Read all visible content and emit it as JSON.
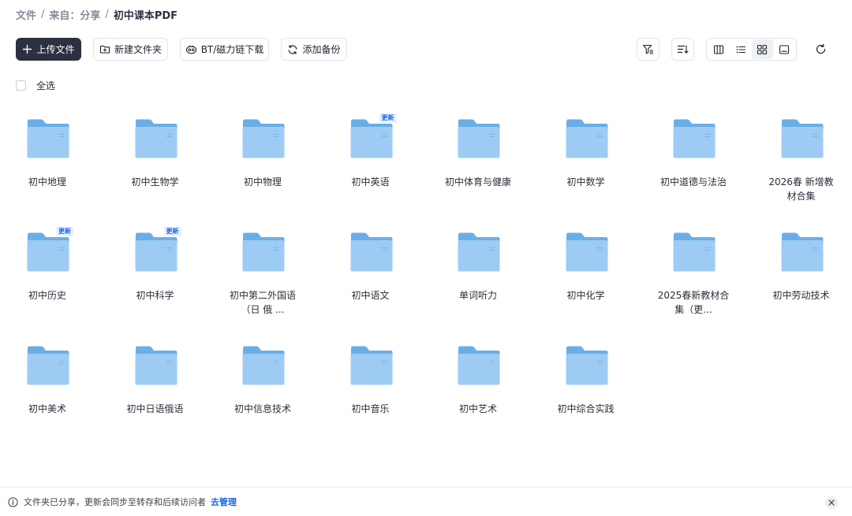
{
  "breadcrumb": {
    "items": [
      "文件",
      "来自：分享"
    ],
    "separator": "/",
    "current": "初中课本PDF"
  },
  "toolbar": {
    "upload_label": "上传文件",
    "new_folder_label": "新建文件夹",
    "bt_label": "BT/磁力链下载",
    "backup_label": "添加备份"
  },
  "select_all_label": "全选",
  "badge_label": "更新",
  "folders": [
    {
      "name": "初中地理",
      "updated": false
    },
    {
      "name": "初中生物学",
      "updated": false
    },
    {
      "name": "初中物理",
      "updated": false
    },
    {
      "name": "初中英语",
      "updated": true
    },
    {
      "name": "初中体育与健康",
      "updated": false
    },
    {
      "name": "初中数学",
      "updated": false
    },
    {
      "name": "初中道德与法治",
      "updated": false
    },
    {
      "name": "2026春 新增教材合集",
      "updated": false
    },
    {
      "name": "初中历史",
      "updated": true
    },
    {
      "name": "初中科学",
      "updated": true
    },
    {
      "name": "初中第二外国语（日 俄 ...",
      "updated": false
    },
    {
      "name": "初中语文",
      "updated": false
    },
    {
      "name": "单词听力",
      "updated": false
    },
    {
      "name": "初中化学",
      "updated": false
    },
    {
      "name": "2025春新教材合集（更...",
      "updated": false
    },
    {
      "name": "初中劳动技术",
      "updated": false
    },
    {
      "name": "初中美术",
      "updated": false
    },
    {
      "name": "初中日语俄语",
      "updated": false
    },
    {
      "name": "初中信息技术",
      "updated": false
    },
    {
      "name": "初中音乐",
      "updated": false
    },
    {
      "name": "初中艺术",
      "updated": false
    },
    {
      "name": "初中综合实践",
      "updated": false
    }
  ],
  "footer": {
    "message": "文件夹已分享，更新会同步至转存和后续访问者",
    "manage_label": "去管理"
  },
  "colors": {
    "primary_button": "#2c3040",
    "link": "#1a66e8",
    "folder_back": "#6aaee8",
    "folder_front": "#9dcbf4"
  },
  "icons": {
    "upload": "plus-icon",
    "new_folder": "folder-plus-icon",
    "bt": "magnet-icon",
    "backup": "sync-icon",
    "filter": "filter-icon",
    "sort": "sort-icon",
    "views": [
      "column-view-icon",
      "list-view-icon",
      "grid-view-icon",
      "preview-view-icon"
    ],
    "refresh": "refresh-icon",
    "info": "info-icon",
    "close": "close-icon"
  }
}
